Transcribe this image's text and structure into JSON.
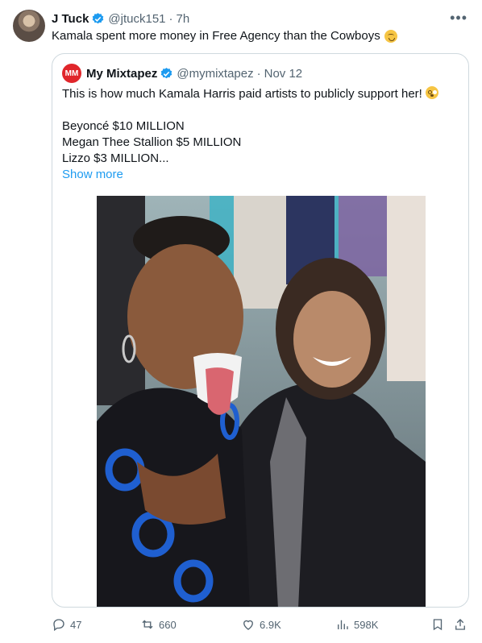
{
  "tweet": {
    "author_name": "J Tuck",
    "handle": "@jtuck151",
    "separator": "·",
    "time": "7h",
    "text": "Kamala spent more money in Free Agency than the Cowboys"
  },
  "quoted": {
    "avatar_text": "MM",
    "author_name": "My Mixtapez",
    "handle": "@mymixtapez",
    "separator": "·",
    "time": "Nov 12",
    "line1": "This is how much Kamala Harris paid artists to publicly support her!",
    "line2": "Beyoncé $10 MILLION",
    "line3": "Megan Thee Stallion $5 MILLION",
    "line4": "Lizzo $3 MILLION...",
    "show_more": "Show more"
  },
  "actions": {
    "replies": "47",
    "reposts": "660",
    "likes": "6.9K",
    "views": "598K"
  },
  "colors": {
    "accent": "#1d9bf0",
    "muted": "#536471",
    "border": "#cfd9de",
    "brand_red": "#e0262b"
  },
  "icons": [
    "verified-badge-icon",
    "more-icon",
    "reply-icon",
    "repost-icon",
    "like-icon",
    "views-icon",
    "bookmark-icon",
    "share-icon"
  ]
}
